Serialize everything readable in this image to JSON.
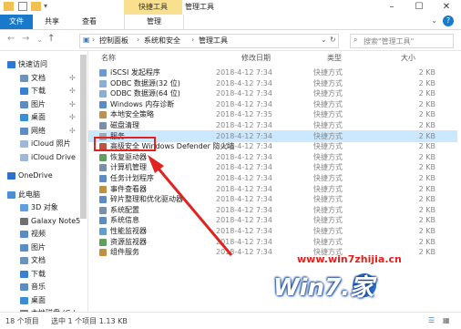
{
  "titlebar": {
    "context_tab": "快捷工具",
    "title": "管理工具"
  },
  "ribbon": {
    "tabs": [
      "文件",
      "共享",
      "查看",
      "管理"
    ]
  },
  "address": {
    "crumbs": [
      "控制面板",
      "系统和安全",
      "管理工具"
    ],
    "search_placeholder": "搜索\"管理工具\""
  },
  "nav": {
    "items": [
      {
        "label": "快速访问",
        "icon": "star-icon",
        "color": "#2b79d8"
      },
      {
        "label": "文档",
        "icon": "document-icon",
        "color": "#6d93b8"
      },
      {
        "label": "下载",
        "icon": "download-icon",
        "color": "#3a7fd0"
      },
      {
        "label": "图片",
        "icon": "picture-icon",
        "color": "#5b8dc4"
      },
      {
        "label": "桌面",
        "icon": "desktop-icon",
        "color": "#3a8ed8"
      },
      {
        "label": "网络",
        "icon": "network-icon",
        "color": "#5b8dc4"
      },
      {
        "label": "iCloud 照片",
        "icon": "cloud-icon",
        "color": "#a0b8d8"
      },
      {
        "label": "iCloud Drive",
        "icon": "cloud-icon",
        "color": "#a0b8d8"
      },
      {
        "label": "OneDrive",
        "icon": "onedrive-icon",
        "color": "#2d6fcf"
      },
      {
        "label": "此电脑",
        "icon": "computer-icon",
        "color": "#4a8fd6"
      },
      {
        "label": "3D 对象",
        "icon": "cube-icon",
        "color": "#5fa0dc"
      },
      {
        "label": "Galaxy Note5",
        "icon": "phone-icon",
        "color": "#707070"
      },
      {
        "label": "视频",
        "icon": "video-icon",
        "color": "#5b8dc4"
      },
      {
        "label": "图片",
        "icon": "picture-icon",
        "color": "#5b8dc4"
      },
      {
        "label": "文档",
        "icon": "document-icon",
        "color": "#6d93b8"
      },
      {
        "label": "下载",
        "icon": "download-icon",
        "color": "#3a7fd0"
      },
      {
        "label": "音乐",
        "icon": "music-icon",
        "color": "#5b8dc4"
      },
      {
        "label": "桌面",
        "icon": "desktop-icon",
        "color": "#3a8ed8"
      },
      {
        "label": "本地磁盘 (C:)",
        "icon": "drive-icon",
        "color": "#808080"
      }
    ]
  },
  "columns": {
    "name": "名称",
    "date": "修改日期",
    "type": "类型",
    "size": "大小"
  },
  "files": [
    {
      "name": "iSCSI 发起程序",
      "date": "2018-4-12 7:34",
      "type": "快捷方式",
      "size": "2 KB"
    },
    {
      "name": "ODBC 数据源(32 位)",
      "date": "2018-4-12 7:34",
      "type": "快捷方式",
      "size": "2 KB"
    },
    {
      "name": "ODBC 数据源(64 位)",
      "date": "2018-4-12 7:34",
      "type": "快捷方式",
      "size": "2 KB"
    },
    {
      "name": "Windows 内存诊断",
      "date": "2018-4-12 7:34",
      "type": "快捷方式",
      "size": "2 KB"
    },
    {
      "name": "本地安全策略",
      "date": "2018-4-12 7:35",
      "type": "快捷方式",
      "size": "2 KB"
    },
    {
      "name": "磁盘清理",
      "date": "2018-4-12 7:34",
      "type": "快捷方式",
      "size": "2 KB"
    },
    {
      "name": "服务",
      "date": "2018-4-12 7:34",
      "type": "快捷方式",
      "size": "2 KB"
    },
    {
      "name": "高级安全 Windows Defender 防火墙",
      "date": "2018-4-12 7:34",
      "type": "快捷方式",
      "size": "2 KB"
    },
    {
      "name": "恢复驱动器",
      "date": "2018-4-12 7:34",
      "type": "快捷方式",
      "size": "2 KB"
    },
    {
      "name": "计算机管理",
      "date": "2018-4-12 7:34",
      "type": "快捷方式",
      "size": "2 KB"
    },
    {
      "name": "任务计划程序",
      "date": "2018-4-12 7:34",
      "type": "快捷方式",
      "size": "2 KB"
    },
    {
      "name": "事件查看器",
      "date": "2018-4-12 7:34",
      "type": "快捷方式",
      "size": "2 KB"
    },
    {
      "name": "碎片整理和优化驱动器",
      "date": "2018-4-12 7:34",
      "type": "快捷方式",
      "size": "2 KB"
    },
    {
      "name": "系统配置",
      "date": "2018-4-12 7:34",
      "type": "快捷方式",
      "size": "2 KB"
    },
    {
      "name": "系统信息",
      "date": "2018-4-12 7:34",
      "type": "快捷方式",
      "size": "2 KB"
    },
    {
      "name": "性能监视器",
      "date": "2018-4-12 7:34",
      "type": "快捷方式",
      "size": "2 KB"
    },
    {
      "name": "资源监视器",
      "date": "2018-4-12 7:34",
      "type": "快捷方式",
      "size": "2 KB"
    },
    {
      "name": "组件服务",
      "date": "2018-4-12 7:34",
      "type": "快捷方式",
      "size": "2 KB"
    }
  ],
  "selected_index": 6,
  "status": {
    "count": "18 个项目",
    "selected": "选中 1 个项目 1.13 KB"
  },
  "watermark": {
    "url": "www.win7zhijia.cn",
    "logo": "Win7.家"
  },
  "colors": {
    "accent": "#1979ca",
    "selection": "#cce8ff",
    "highlight_box": "#e0231e",
    "context_tab": "#f8e08e"
  }
}
